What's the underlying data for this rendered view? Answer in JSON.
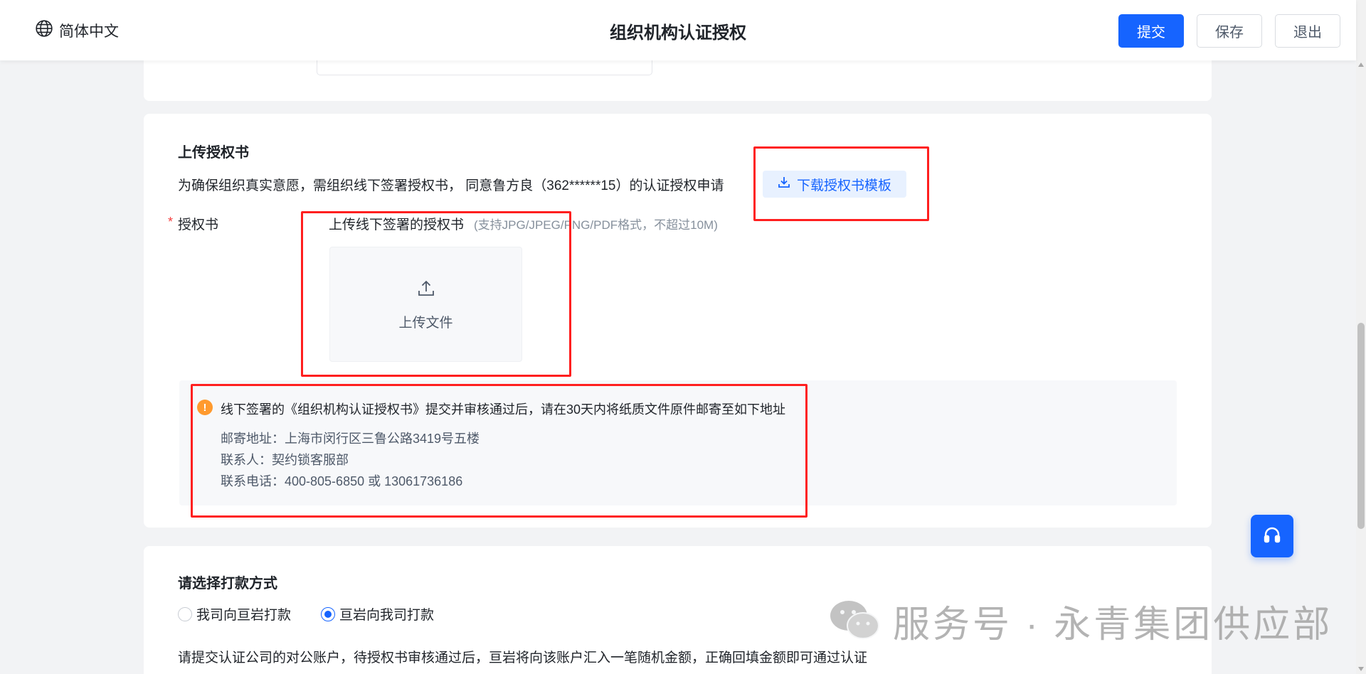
{
  "header": {
    "lang_label": "简体中文",
    "title": "组织机构认证授权",
    "submit_label": "提交",
    "save_label": "保存",
    "exit_label": "退出"
  },
  "upload_section": {
    "title": "上传授权书",
    "description": "为确保组织真实意愿，需组织线下签署授权书， 同意鲁方良（362******15）的认证授权申请",
    "download_label": "下载授权书模板",
    "required_mark": "*",
    "field_label": "授权书",
    "upload_hint": "上传线下签署的授权书",
    "upload_format_hint": "(支持JPG/JPEG/PNG/PDF格式，不超过10M)",
    "upload_button_text": "上传文件"
  },
  "notice": {
    "main": "线下签署的《组织机构认证授权书》提交并审核通过后，请在30天内将纸质文件原件邮寄至如下地址",
    "address": "邮寄地址：上海市闵行区三鲁公路3419号五楼",
    "contact": "联系人：契约锁客服部",
    "phone": "联系电话：400-805-6850 或 13061736186"
  },
  "payment": {
    "title": "请选择打款方式",
    "options": [
      {
        "label": "我司向亘岩打款",
        "selected": false
      },
      {
        "label": "亘岩向我司打款",
        "selected": true
      }
    ],
    "description": "请提交认证公司的对公账户，待授权书审核通过后，亘岩将向该账户汇入一笔随机金额，正确回填金额即可通过认证"
  },
  "watermark": {
    "text": "服务号 · 永青集团供应部"
  },
  "colors": {
    "accent": "#1664ff",
    "annotation": "#ff1f1f",
    "warning": "#ff9a2e"
  },
  "icons": [
    "globe-icon",
    "download-icon",
    "upload-icon",
    "warning-icon",
    "headset-icon",
    "wechat-icon"
  ]
}
